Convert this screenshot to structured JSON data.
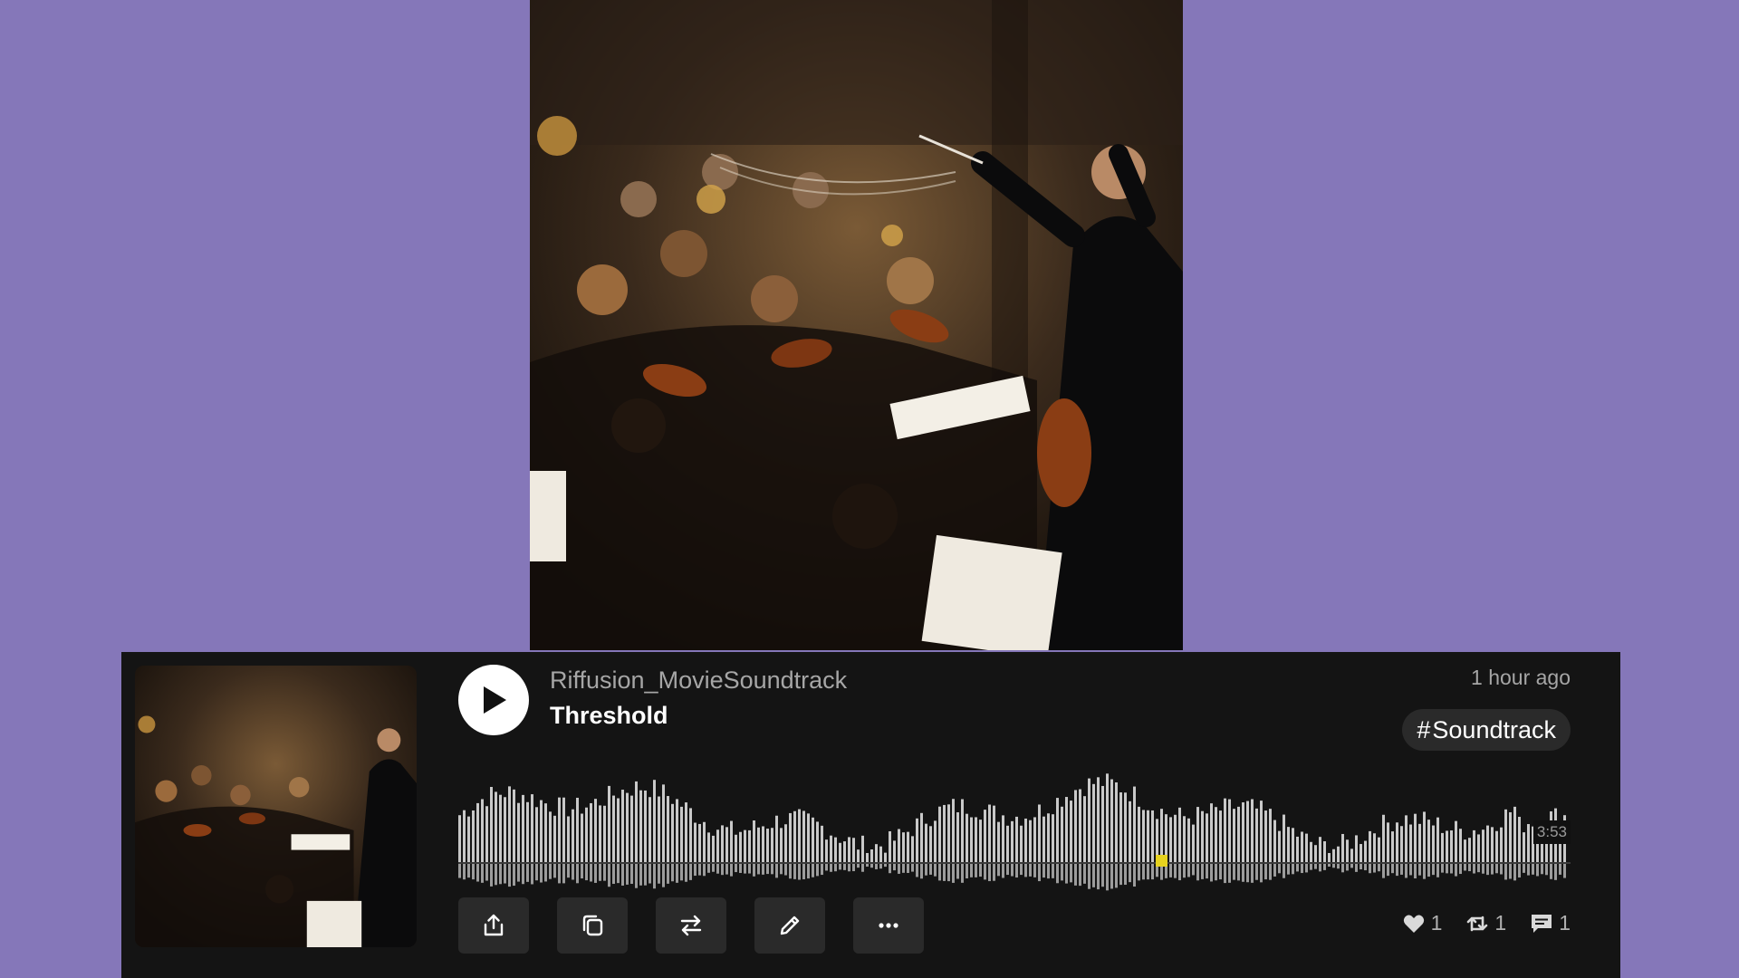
{
  "track": {
    "artist": "Riffusion_MovieSoundtrack",
    "title": "Threshold",
    "posted": "1 hour ago",
    "tag_symbol": "#",
    "tag": "Soundtrack",
    "duration": "3:53",
    "progress": 0
  },
  "stats": {
    "likes": "1",
    "remixes": "1",
    "comments": "1"
  },
  "icons": {
    "play": "play-icon",
    "share": "share-icon",
    "copy": "copy-icon",
    "swap": "swap-icon",
    "edit": "pencil-icon",
    "more": "more-icon",
    "like": "heart-icon",
    "remix": "repost-icon",
    "comment": "comment-icon"
  },
  "colors": {
    "background": "#8577b9",
    "card": "#141414",
    "button": "#2a2a2a",
    "waveform": "#c9c9c9",
    "marker": "#e6d21f"
  }
}
